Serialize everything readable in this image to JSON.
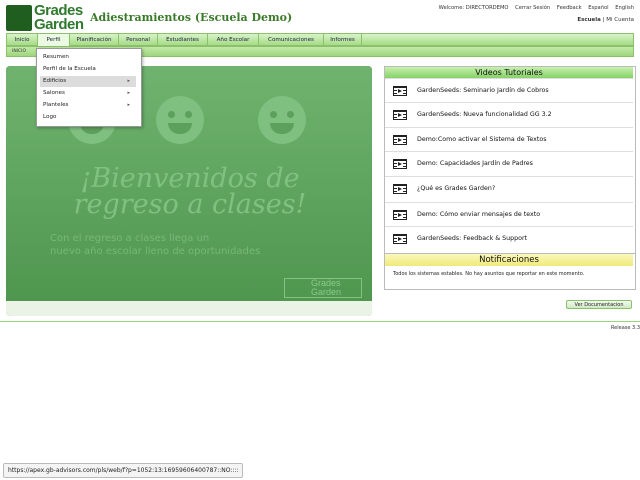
{
  "header": {
    "logo_line1": "Grades",
    "logo_line2": "Garden",
    "app_title": "Adiestramientos (Escuela Demo)",
    "welcome": "Welcome: DIRECTORDEMO",
    "logout": "Cerrar Sesión",
    "feedback": "Feedback",
    "lang_es": "Español",
    "lang_en": "English",
    "school_link": "Escuela",
    "separator": "|",
    "account_link": "Mi Cuenta"
  },
  "nav": {
    "tabs": [
      "Inicio",
      "Perfil",
      "Planificación",
      "Personal",
      "Estudiantes",
      "Año Escolar",
      "Comunicaciones",
      "Informes"
    ],
    "active": "Perfil",
    "sub_label": "INICIO"
  },
  "dropdown": {
    "items": [
      {
        "label": "Resumen",
        "submenu": false
      },
      {
        "label": "Perfil de la Escuela",
        "submenu": false
      },
      {
        "label": "Edificios",
        "submenu": true
      },
      {
        "label": "Salones",
        "submenu": true
      },
      {
        "label": "Planteles",
        "submenu": true
      },
      {
        "label": "Logo",
        "submenu": false
      }
    ],
    "highlighted": "Edificios",
    "arrow_glyph": "▸"
  },
  "banner": {
    "title_line1": "¡Bienvenidos de",
    "title_line2": "regreso a clases!",
    "sub_line1": "Con el regreso a clases llega un",
    "sub_line2": "nuevo año escolar lleno de oportunidades",
    "logo_line1": "Grades",
    "logo_line2": "Garden"
  },
  "videos": {
    "title": "Videos Tutoriales",
    "items": [
      "GardenSeeds: Seminario Jardín de Cobros",
      "GardenSeeds: Nueva funcionalidad GG 3.2",
      "Demo:Como activar el Sistema de Textos",
      "Demo: Capacidades Jardín de Padres",
      "¿Qué es Grades Garden?",
      "Demo: Cómo enviar mensajes de texto",
      "GardenSeeds: Feedback & Support"
    ]
  },
  "notifications": {
    "title": "Notificaciones",
    "text": "Todos los sistemas estables. No hay asuntos que reportar en este momento."
  },
  "view_docs_label": "Ver Documentacion",
  "release": "Release 3.3",
  "status_url": "https://apex.gb-advisors.com/pls/web/f?p=1052:13:16959606400787::NO::::",
  "colors": {
    "brand_green": "#2f7a2f",
    "nav_green": "#a6dc86",
    "banner_green": "#5fa25f",
    "notif_yellow": "#f0ea7a"
  }
}
